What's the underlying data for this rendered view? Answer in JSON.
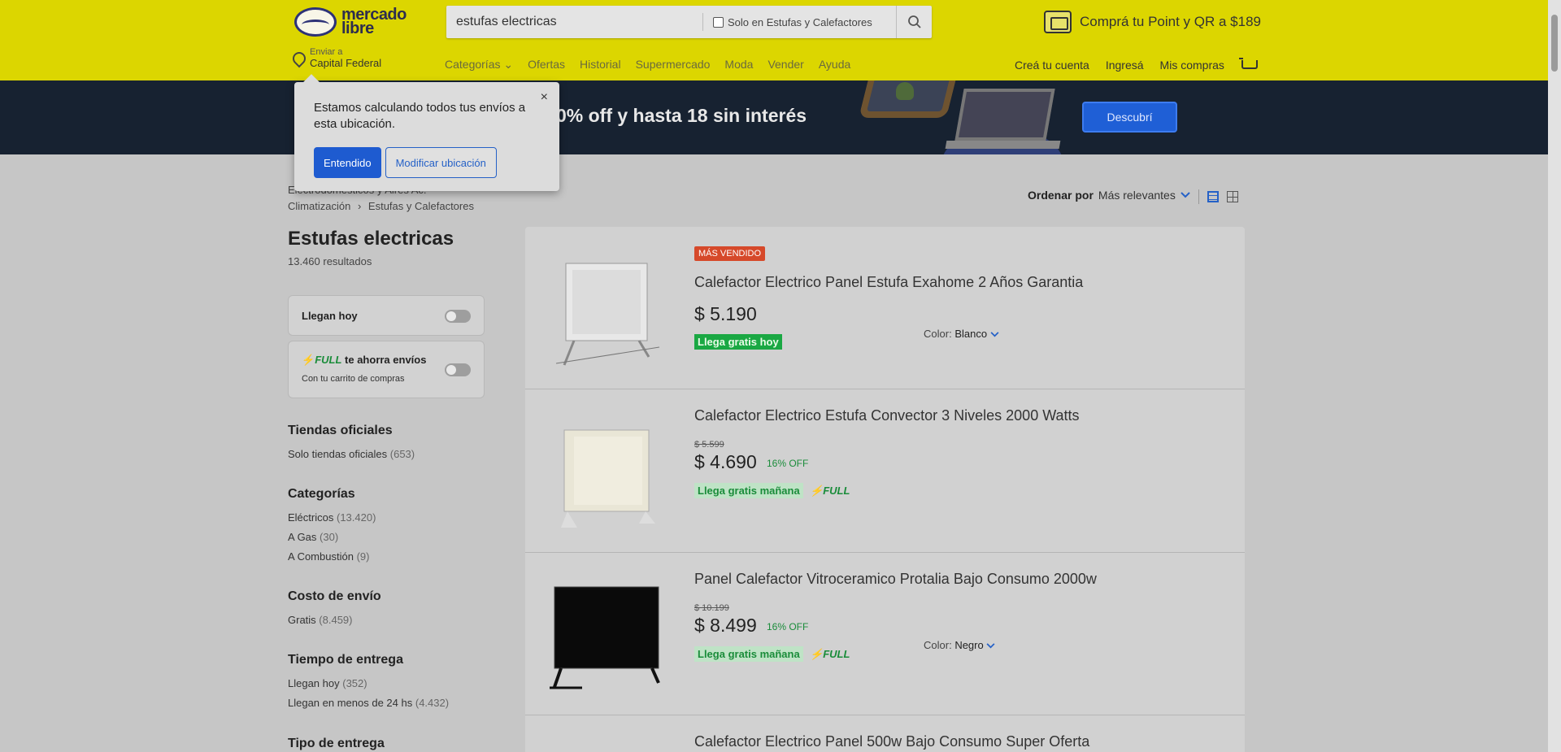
{
  "header": {
    "logo_line1": "mercado",
    "logo_line2": "libre",
    "search_value": "estufas electricas",
    "search_filter_label": "Solo en Estufas y Calefactores",
    "promo_text": "Comprá tu Point y QR a $189",
    "location_small": "Enviar a",
    "location_big": "Capital Federal",
    "nav": [
      "Categorías ⌄",
      "Ofertas",
      "Historial",
      "Supermercado",
      "Moda",
      "Vender",
      "Ayuda"
    ],
    "nav_right": [
      "Creá tu cuenta",
      "Ingresá",
      "Mis compras"
    ]
  },
  "banner": {
    "text": "a 40% off y hasta 18 sin interés",
    "button": "Descubrí"
  },
  "popup": {
    "text": "Estamos calculando todos tus envíos a esta ubicación.",
    "btn_ok": "Entendido",
    "btn_modify": "Modificar ubicación",
    "close": "×"
  },
  "breadcrumb": {
    "line1": "Electrodomésticos y Aires Ac.",
    "line2a": "Climatización",
    "sep": "›",
    "line2b": "Estufas y Calefactores"
  },
  "sort": {
    "label": "Ordenar por",
    "value": "Más relevantes"
  },
  "sidebar": {
    "title": "Estufas electricas",
    "results": "13.460 resultados",
    "llegan_hoy": "Llegan hoy",
    "full_label": "FULL",
    "full_text": "te ahorra envíos",
    "full_sub": "Con tu carrito de compras",
    "sections": [
      {
        "title": "Tiendas oficiales",
        "items": [
          {
            "label": "Solo tiendas oficiales",
            "count": "(653)"
          }
        ]
      },
      {
        "title": "Categorías",
        "items": [
          {
            "label": "Eléctricos",
            "count": "(13.420)"
          },
          {
            "label": "A Gas",
            "count": "(30)"
          },
          {
            "label": "A Combustión",
            "count": "(9)"
          }
        ]
      },
      {
        "title": "Costo de envío",
        "items": [
          {
            "label": "Gratis",
            "count": "(8.459)"
          }
        ]
      },
      {
        "title": "Tiempo de entrega",
        "items": [
          {
            "label": "Llegan hoy",
            "count": "(352)"
          },
          {
            "label": "Llegan en menos de 24 hs",
            "count": "(4.432)"
          }
        ]
      },
      {
        "title": "Tipo de entrega",
        "items": []
      }
    ]
  },
  "items": [
    {
      "badge": "MÁS VENDIDO",
      "title": "Calefactor Electrico Panel Estufa Exahome 2 Años Garantia",
      "price": "$ 5.190",
      "shipping": "Llega gratis hoy",
      "color_label": "Color:",
      "color_value": "Blanco"
    },
    {
      "title": "Calefactor Electrico Estufa Convector 3 Niveles 2000 Watts",
      "old_price": "$ 5.599",
      "price": "$ 4.690",
      "discount": "16% OFF",
      "shipping": "Llega gratis mañana",
      "full": "FULL"
    },
    {
      "title": "Panel Calefactor Vitroceramico Protalia Bajo Consumo 2000w",
      "old_price": "$ 10.199",
      "price": "$ 8.499",
      "discount": "16% OFF",
      "shipping": "Llega gratis mañana",
      "full": "FULL",
      "color_label": "Color:",
      "color_value": "Negro"
    },
    {
      "title": "Calefactor Electrico Panel 500w Bajo Consumo Super Oferta"
    }
  ]
}
